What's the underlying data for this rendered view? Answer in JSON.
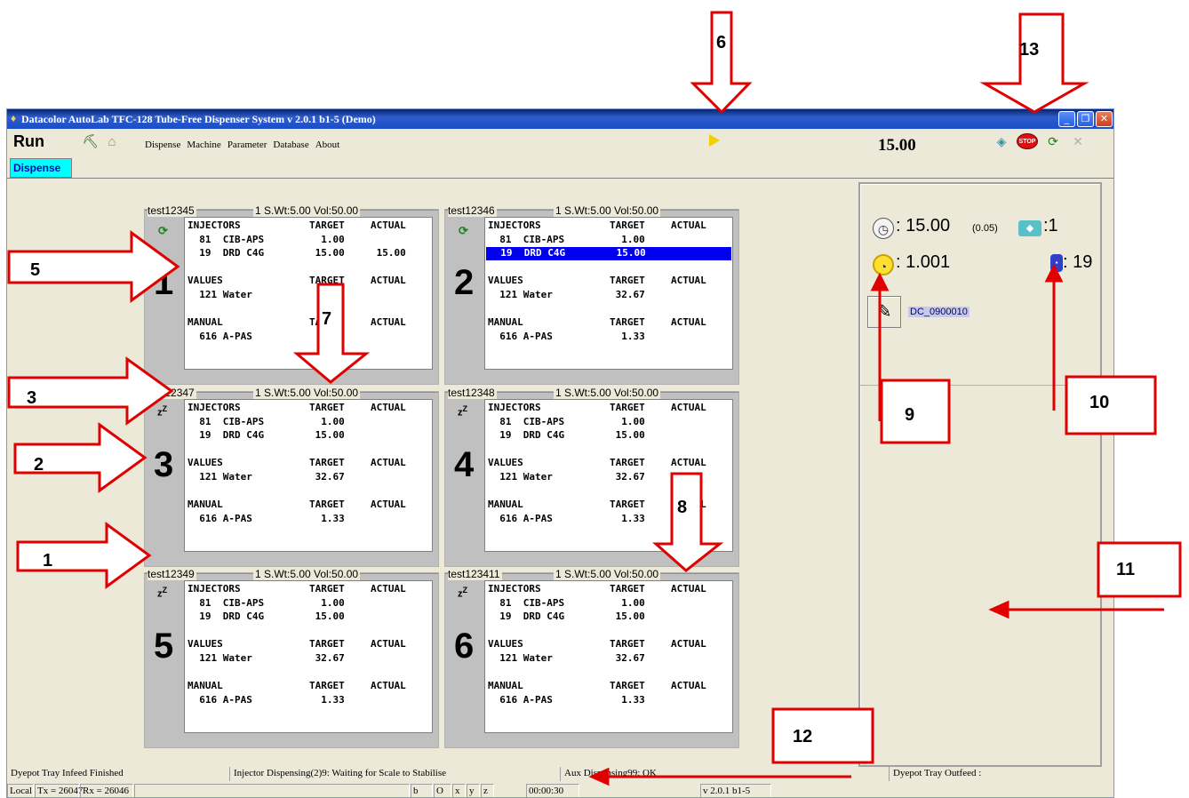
{
  "window": {
    "title": "Datacolor AutoLab TFC-128 Tube-Free Dispenser System v 2.0.1 b1-5 (Demo)",
    "minimize": "_",
    "maximize": "❐",
    "close": "✕"
  },
  "toolbar": {
    "run_label": "Run",
    "weight_value": "15.00",
    "stop_label": "STOP"
  },
  "menu": [
    "Dispense",
    "Machine",
    "Parameter",
    "Database",
    "About"
  ],
  "tab": "Dispense",
  "pots": [
    {
      "name": "test12345",
      "wt": "1 S.Wt:5.00   Vol:50.00",
      "number": "1",
      "status": "refresh-icon",
      "rows": [
        [
          "INJECTORS",
          "TARGET",
          "ACTUAL"
        ],
        [
          "  81  CIB-APS",
          "  1.00",
          ""
        ],
        [
          "  19  DRD C4G",
          " 15.00",
          " 15.00"
        ],
        [
          "",
          "",
          ""
        ],
        [
          "VALUES",
          "TARGET",
          "ACTUAL"
        ],
        [
          "  121 Water",
          "",
          ""
        ],
        [
          "",
          "",
          ""
        ],
        [
          "MANUAL",
          "TARGET",
          "ACTUAL"
        ],
        [
          "  616 A-PAS",
          "",
          ""
        ]
      ],
      "highlight": -1
    },
    {
      "name": "test12346",
      "wt": "1 S.Wt:5.00   Vol:50.00",
      "number": "2",
      "status": "refresh-icon",
      "rows": [
        [
          "INJECTORS",
          "TARGET",
          "ACTUAL"
        ],
        [
          "  81  CIB-APS",
          "  1.00",
          ""
        ],
        [
          "  19  DRD C4G",
          " 15.00",
          ""
        ],
        [
          "",
          "",
          ""
        ],
        [
          "VALUES",
          "TARGET",
          "ACTUAL"
        ],
        [
          "  121 Water",
          " 32.67",
          ""
        ],
        [
          "",
          "",
          ""
        ],
        [
          "MANUAL",
          "TARGET",
          "ACTUAL"
        ],
        [
          "  616 A-PAS",
          "  1.33",
          ""
        ]
      ],
      "highlight": 2
    },
    {
      "name": "test12347",
      "wt": "1 S.Wt:5.00   Vol:50.00",
      "number": "3",
      "status": "sleep-icon",
      "rows": [
        [
          "INJECTORS",
          "TARGET",
          "ACTUAL"
        ],
        [
          "  81  CIB-APS",
          "  1.00",
          ""
        ],
        [
          "  19  DRD C4G",
          " 15.00",
          ""
        ],
        [
          "",
          "",
          ""
        ],
        [
          "VALUES",
          "TARGET",
          "ACTUAL"
        ],
        [
          "  121 Water",
          " 32.67",
          ""
        ],
        [
          "",
          "",
          ""
        ],
        [
          "MANUAL",
          "TARGET",
          "ACTUAL"
        ],
        [
          "  616 A-PAS",
          "  1.33",
          ""
        ]
      ],
      "highlight": -1
    },
    {
      "name": "test12348",
      "wt": "1 S.Wt:5.00   Vol:50.00",
      "number": "4",
      "status": "sleep-icon",
      "rows": [
        [
          "INJECTORS",
          "TARGET",
          "ACTUAL"
        ],
        [
          "  81  CIB-APS",
          "  1.00",
          ""
        ],
        [
          "  19  DRD C4G",
          " 15.00",
          ""
        ],
        [
          "",
          "",
          ""
        ],
        [
          "VALUES",
          "TARGET",
          "ACTUAL"
        ],
        [
          "  121 Water",
          " 32.67",
          ""
        ],
        [
          "",
          "",
          ""
        ],
        [
          "MANUAL",
          "TARGET",
          "ACTUAL"
        ],
        [
          "  616 A-PAS",
          "  1.33",
          ""
        ]
      ],
      "highlight": -1
    },
    {
      "name": "test12349",
      "wt": "1 S.Wt:5.00   Vol:50.00",
      "number": "5",
      "status": "sleep-icon",
      "rows": [
        [
          "INJECTORS",
          "TARGET",
          "ACTUAL"
        ],
        [
          "  81  CIB-APS",
          "  1.00",
          ""
        ],
        [
          "  19  DRD C4G",
          " 15.00",
          ""
        ],
        [
          "",
          "",
          ""
        ],
        [
          "VALUES",
          "TARGET",
          "ACTUAL"
        ],
        [
          "  121 Water",
          " 32.67",
          ""
        ],
        [
          "",
          "",
          ""
        ],
        [
          "MANUAL",
          "TARGET",
          "ACTUAL"
        ],
        [
          "  616 A-PAS",
          "  1.33",
          ""
        ]
      ],
      "highlight": -1
    },
    {
      "name": "test123411",
      "wt": "1 S.Wt:5.00   Vol:50.00",
      "number": "6",
      "status": "sleep-icon",
      "rows": [
        [
          "INJECTORS",
          "TARGET",
          "ACTUAL"
        ],
        [
          "  81  CIB-APS",
          "  1.00",
          ""
        ],
        [
          "  19  DRD C4G",
          " 15.00",
          ""
        ],
        [
          "",
          "",
          ""
        ],
        [
          "VALUES",
          "TARGET",
          "ACTUAL"
        ],
        [
          "  121 Water",
          " 32.67",
          ""
        ],
        [
          "",
          "",
          ""
        ],
        [
          "MANUAL",
          "TARGET",
          "ACTUAL"
        ],
        [
          "  616 A-PAS",
          "  1.33",
          ""
        ]
      ],
      "highlight": -1
    }
  ],
  "info": {
    "scale_reading": ": 15.00",
    "scale_tolerance": "(0.05)",
    "tray_count": ":1",
    "gauge_reading": ": 1.001",
    "bottle_number": ": 19",
    "dc_label": "DC_0900010"
  },
  "status_bar": {
    "c1": "Dyepot Tray Infeed Finished",
    "c2": "Injector Dispensing(2)9: Waiting for Scale to Stabilise",
    "c3": "Aux Dispensing99: OK",
    "c4": "Dyepot Tray Outfeed :"
  },
  "status_bar2": {
    "local": "Local",
    "tx": "Tx = 26047",
    "rx": "Rx = 26046",
    "b": "b",
    "o": "O",
    "x": "x",
    "y": "y",
    "z": "z",
    "time": "00:00:30",
    "version": "v 2.0.1 b1-5"
  },
  "annotations": [
    "1",
    "2",
    "3",
    "5",
    "6",
    "7",
    "8",
    "9",
    "10",
    "11",
    "12",
    "13"
  ],
  "colors": {
    "annotation": "#e00000",
    "titlebar": "#0a246a",
    "highlight": "#0000ee",
    "tab": "#00ffff"
  }
}
